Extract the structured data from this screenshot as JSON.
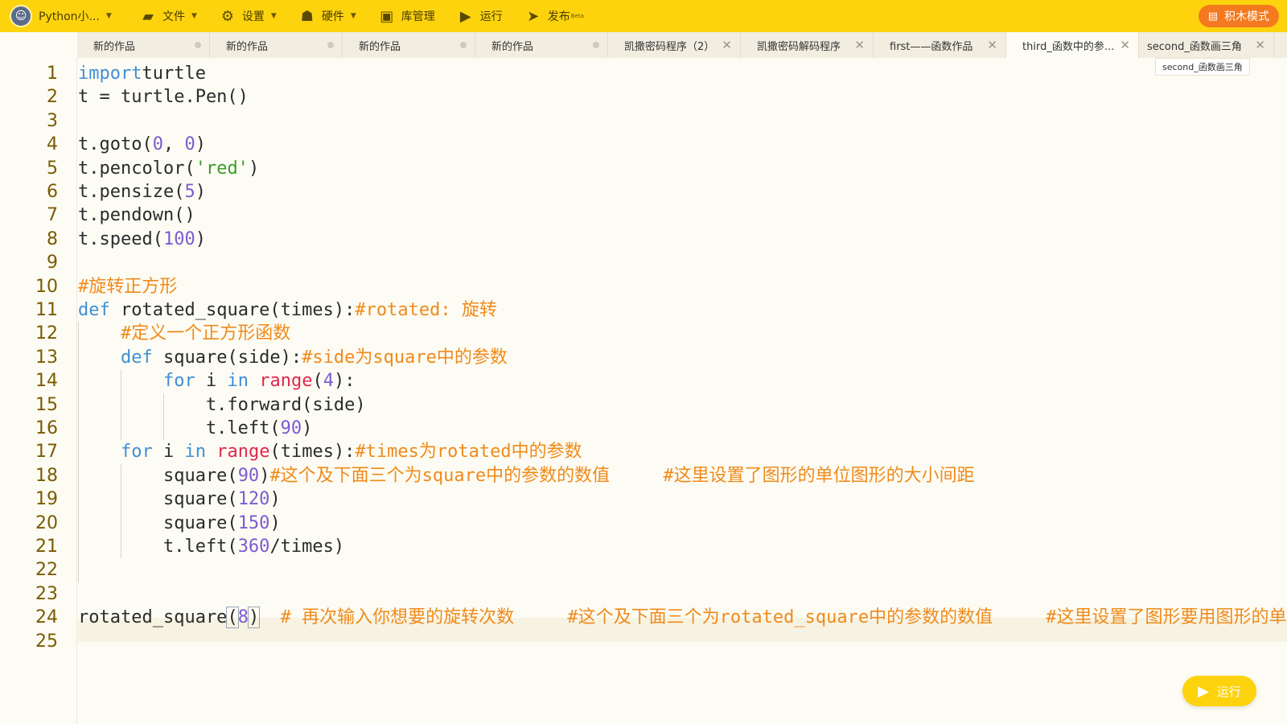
{
  "app": {
    "user_name": "Python小...",
    "menu": [
      {
        "icon": "folder-icon",
        "label": "文件",
        "has_caret": true
      },
      {
        "icon": "gear-icon",
        "label": "设置",
        "has_caret": true
      },
      {
        "icon": "hardware-icon",
        "label": "硬件",
        "has_caret": true
      },
      {
        "icon": "library-icon",
        "label": "库管理",
        "has_caret": false
      },
      {
        "icon": "play-circle-icon",
        "label": "运行",
        "has_caret": false
      },
      {
        "icon": "send-icon",
        "label": "发布",
        "badge": "Beta",
        "has_caret": false
      }
    ],
    "block_mode_label": "积木模式"
  },
  "tabs": [
    {
      "label": "新的作品",
      "status": "unsaved"
    },
    {
      "label": "新的作品",
      "status": "unsaved"
    },
    {
      "label": "新的作品",
      "status": "unsaved"
    },
    {
      "label": "新的作品",
      "status": "unsaved"
    },
    {
      "label": "凯撒密码程序（2）",
      "status": "closable"
    },
    {
      "label": "凯撒密码解码程序",
      "status": "closable"
    },
    {
      "label": "first——函数作品",
      "status": "closable"
    },
    {
      "label": "third_函数中的参...",
      "status": "closable",
      "active": true
    },
    {
      "label": "second_函数画三角",
      "status": "closable"
    }
  ],
  "tooltip": "second_函数画三角",
  "editor": {
    "line_numbers": [
      "1",
      "2",
      "3",
      "4",
      "5",
      "6",
      "7",
      "8",
      "9",
      "10",
      "11",
      "12",
      "13",
      "14",
      "15",
      "16",
      "17",
      "18",
      "19",
      "20",
      "21",
      "22",
      "23",
      "24",
      "25"
    ],
    "lines": [
      [
        [
          "kw",
          "import"
        ],
        [
          "",
          "turtle"
        ]
      ],
      [
        [
          "",
          "t = turtle.Pen()"
        ]
      ],
      [],
      [
        [
          "",
          "t.goto("
        ],
        [
          "num",
          "0"
        ],
        [
          "",
          ", "
        ],
        [
          "num",
          "0"
        ],
        [
          "",
          ")"
        ]
      ],
      [
        [
          "",
          "t.pencolor("
        ],
        [
          "str",
          "'red'"
        ],
        [
          "",
          ")"
        ]
      ],
      [
        [
          "",
          "t.pensize("
        ],
        [
          "num",
          "5"
        ],
        [
          "",
          ")"
        ]
      ],
      [
        [
          "",
          "t.pendown()"
        ]
      ],
      [
        [
          "",
          "t.speed("
        ],
        [
          "num",
          "100"
        ],
        [
          "",
          ")"
        ]
      ],
      [],
      [
        [
          "cmt",
          "#旋转正方形"
        ]
      ],
      [
        [
          "kw",
          "def"
        ],
        [
          "",
          " rotated_square(times):"
        ],
        [
          "cmt",
          "#rotated: 旋转"
        ]
      ],
      [
        [
          "",
          "    "
        ],
        [
          "cmt",
          "#定义一个正方形函数"
        ]
      ],
      [
        [
          "",
          "    "
        ],
        [
          "kw",
          "def"
        ],
        [
          "",
          " square(side):"
        ],
        [
          "cmt",
          "#side为square中的参数"
        ]
      ],
      [
        [
          "",
          "        "
        ],
        [
          "kw",
          "for"
        ],
        [
          "",
          " i "
        ],
        [
          "kw",
          "in"
        ],
        [
          "",
          " "
        ],
        [
          "fn",
          "range"
        ],
        [
          "",
          "("
        ],
        [
          "num",
          "4"
        ],
        [
          "",
          "):"
        ]
      ],
      [
        [
          "",
          "            t.forward(side)"
        ]
      ],
      [
        [
          "",
          "            t.left("
        ],
        [
          "num",
          "90"
        ],
        [
          "",
          ")"
        ]
      ],
      [
        [
          "",
          "    "
        ],
        [
          "kw",
          "for"
        ],
        [
          "",
          " i "
        ],
        [
          "kw",
          "in"
        ],
        [
          "",
          " "
        ],
        [
          "fn",
          "range"
        ],
        [
          "",
          "(times):"
        ],
        [
          "cmt",
          "#times为rotated中的参数"
        ]
      ],
      [
        [
          "",
          "        square("
        ],
        [
          "num",
          "90"
        ],
        [
          "",
          ")"
        ],
        [
          "cmt",
          "#这个及下面三个为square中的参数的数值     #这里设置了图形的单位图形的大小间距"
        ]
      ],
      [
        [
          "",
          "        square("
        ],
        [
          "num",
          "120"
        ],
        [
          "",
          ")"
        ]
      ],
      [
        [
          "",
          "        square("
        ],
        [
          "num",
          "150"
        ],
        [
          "",
          ")"
        ]
      ],
      [
        [
          "",
          "        t.left("
        ],
        [
          "num",
          "360"
        ],
        [
          "",
          "/times)"
        ]
      ],
      [],
      [],
      [
        [
          "",
          "rotated_square"
        ],
        [
          "box",
          "("
        ],
        [
          "num",
          "8"
        ],
        [
          "box",
          ")"
        ],
        [
          "cmt",
          "  # 再次输入你想要的旋转次数     #这个及下面三个为rotated_square中的参数的数值     #这里设置了图形要用图形的单位距"
        ]
      ],
      []
    ]
  },
  "run_button_label": "运行"
}
